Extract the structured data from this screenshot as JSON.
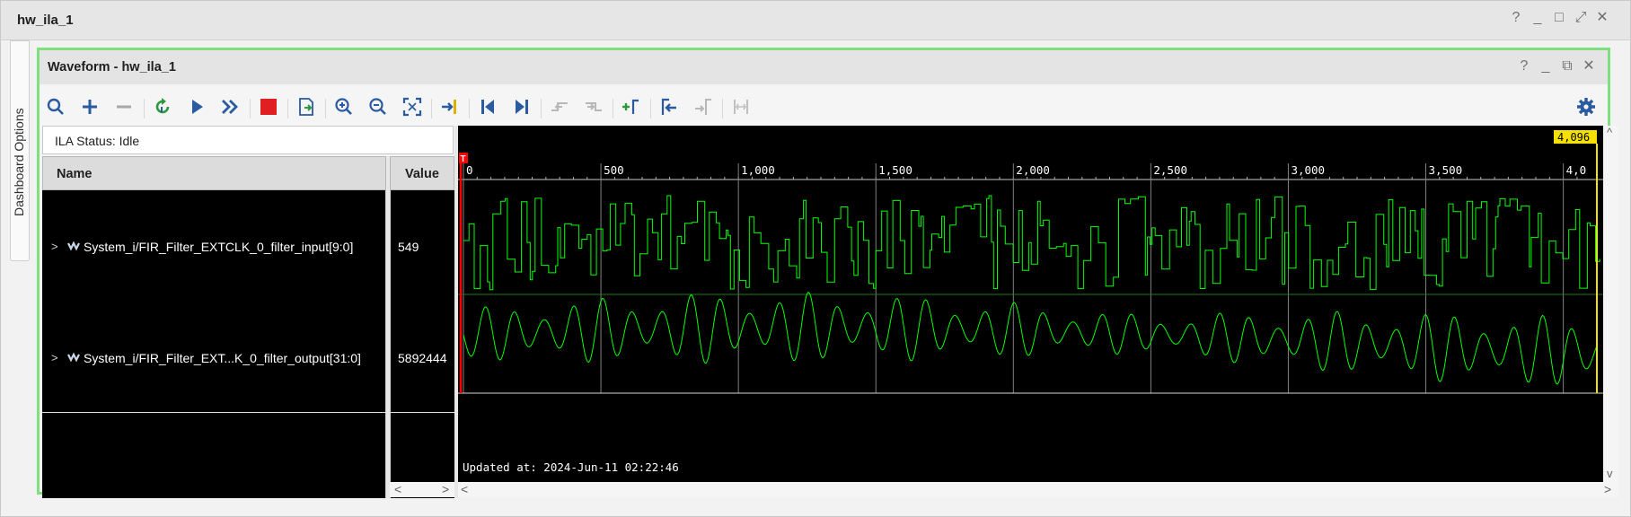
{
  "outer_window": {
    "title": "hw_ila_1",
    "controls": [
      "?",
      "_",
      "□",
      "⤢",
      "✕"
    ]
  },
  "side_tab": {
    "label": "Dashboard Options"
  },
  "waveform_window": {
    "title": "Waveform - hw_ila_1",
    "controls": [
      "?",
      "_",
      "⧉",
      "✕"
    ]
  },
  "toolbar": {
    "buttons": [
      "search",
      "add",
      "remove",
      "refresh",
      "run-trigger",
      "run-immediate",
      "stop",
      "export",
      "zoom-in",
      "zoom-out",
      "zoom-fit",
      "go-to-cursor",
      "go-to-start",
      "go-to-end",
      "prev-transition",
      "next-transition",
      "add-marker",
      "prev-marker",
      "next-marker",
      "swap-markers"
    ],
    "settings_icon": "gear-icon"
  },
  "ila_status": {
    "label": "ILA Status:",
    "value": "Idle"
  },
  "columns": {
    "name": "Name",
    "value": "Value"
  },
  "signals": [
    {
      "name": "System_i/FIR_Filter_EXTCLK_0_filter_input[9:0]",
      "value": "549"
    },
    {
      "name": "System_i/FIR_Filter_EXT...K_0_filter_output[31:0]",
      "value": "5892444"
    }
  ],
  "waveform": {
    "time_ticks": [
      "0",
      "500",
      "1,000",
      "1,500",
      "2,000",
      "2,500",
      "3,000",
      "3,500",
      "4,0"
    ],
    "time_max": 4096,
    "cursor_label": "4,096",
    "trigger_marker": "T",
    "updated_text": "Updated at: 2024-Jun-11 02:22:46",
    "colors": {
      "wave": "#00ff00",
      "grid": "#808080",
      "trigger": "#ff0000",
      "cursor": "#f5e000"
    }
  },
  "scroll": {
    "left": "<",
    "right": ">",
    "up": "^",
    "down": "v"
  }
}
